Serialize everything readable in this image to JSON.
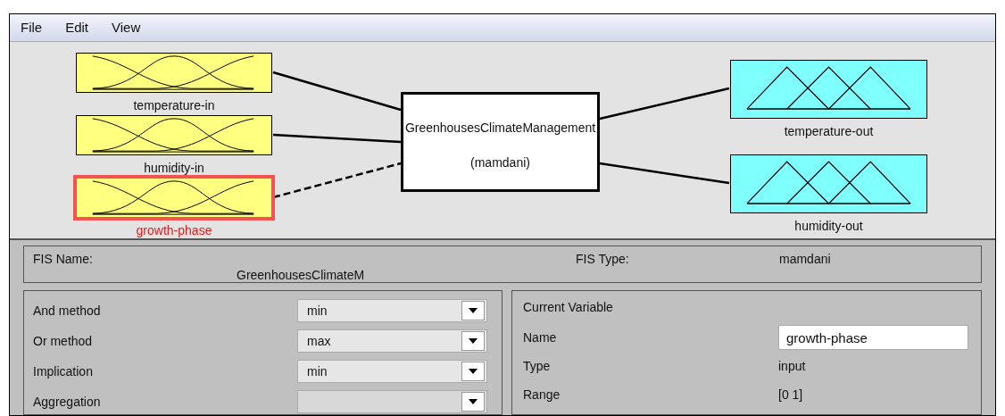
{
  "menu": [
    {
      "label": "File"
    },
    {
      "label": "Edit"
    },
    {
      "label": "View"
    }
  ],
  "diagram": {
    "inputs": [
      {
        "label": "temperature-in",
        "selected": false
      },
      {
        "label": "humidity-in",
        "selected": false
      },
      {
        "label": "growth-phase",
        "selected": true
      }
    ],
    "system": {
      "name": "GreenhousesClimateManagement",
      "type": "(mamdani)"
    },
    "outputs": [
      {
        "label": "temperature-out",
        "selected": false
      },
      {
        "label": "humidity-out",
        "selected": false
      }
    ]
  },
  "fis": {
    "name_label": "FIS Name:",
    "name_value": "GreenhousesClimateM",
    "type_label": "FIS Type:",
    "type_value": "mamdani"
  },
  "methods": [
    {
      "label": "And method",
      "value": "min"
    },
    {
      "label": "Or method",
      "value": "max"
    },
    {
      "label": "Implication",
      "value": "min"
    },
    {
      "label": "Aggregation"
    }
  ],
  "current_variable": {
    "title": "Current Variable",
    "fields": [
      {
        "label": "Name",
        "value": "growth-phase",
        "kind": "field"
      },
      {
        "label": "Type",
        "value": "input",
        "kind": "text"
      },
      {
        "label": "Range",
        "value": "[0 1]",
        "kind": "text"
      }
    ]
  }
}
